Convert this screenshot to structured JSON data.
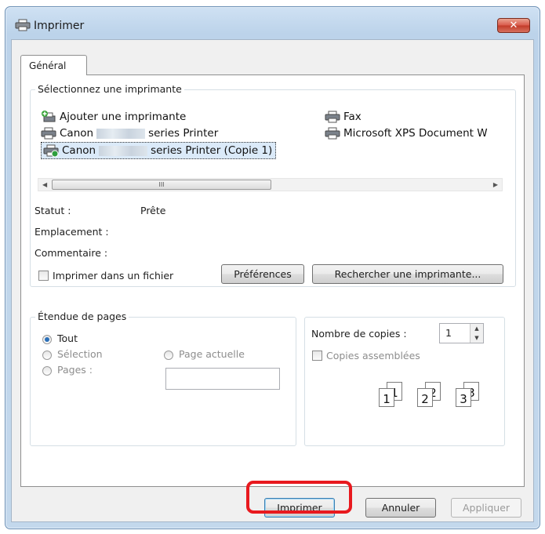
{
  "window": {
    "title": "Imprimer",
    "close_label": "✕"
  },
  "tabs": [
    {
      "label": "Général"
    }
  ],
  "printer_group": {
    "legend": "Sélectionnez une imprimante",
    "printers": [
      {
        "label": "Ajouter une imprimante"
      },
      {
        "label_prefix": "Canon",
        "label_suffix": "series Printer"
      },
      {
        "label_prefix": "Canon",
        "label_suffix": "series Printer (Copie 1)"
      },
      {
        "label": "Fax"
      },
      {
        "label": "Microsoft XPS Document W"
      }
    ],
    "scroll_grip": "III"
  },
  "status": {
    "statut_label": "Statut :",
    "statut_value": "Prête",
    "emplacement_label": "Emplacement :",
    "commentaire_label": "Commentaire :"
  },
  "print_to_file_label": "Imprimer dans un fichier",
  "preferences_button": "Préférences",
  "find_printer_button": "Rechercher une imprimante...",
  "page_range": {
    "legend": "Étendue de pages",
    "tout": "Tout",
    "selection": "Sélection",
    "page_actuelle": "Page actuelle",
    "pages": "Pages :",
    "pages_value": ""
  },
  "copies": {
    "label": "Nombre de copies :",
    "value": "1",
    "collate_label": "Copies assemblées",
    "collate_pages": [
      "1",
      "1",
      "2",
      "2",
      "3",
      "3"
    ]
  },
  "buttons": {
    "print": "Imprimer",
    "cancel": "Annuler",
    "apply": "Appliquer"
  },
  "colors": {
    "highlight": "#e8191e",
    "titlebar": "#bcd3ea"
  }
}
